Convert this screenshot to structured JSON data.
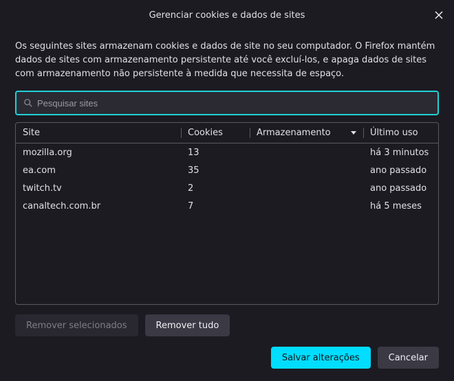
{
  "dialog": {
    "title": "Gerenciar cookies e dados de sites",
    "description": "Os seguintes sites armazenam cookies e dados de site no seu computador. O Firefox mantém dados de sites com armazenamento persistente até você excluí-los, e apaga dados de sites com armazenamento não persistente à medida que necessita de espaço."
  },
  "search": {
    "placeholder": "Pesquisar sites",
    "value": ""
  },
  "table": {
    "columns": {
      "site": "Site",
      "cookies": "Cookies",
      "storage": "Armazenamento",
      "lastused": "Último uso"
    },
    "sort": {
      "column": "storage",
      "dir": "desc"
    },
    "rows": [
      {
        "site": "mozilla.org",
        "cookies": "13",
        "storage": "",
        "lastused": "há 3 minutos"
      },
      {
        "site": "ea.com",
        "cookies": "35",
        "storage": "",
        "lastused": "ano passado"
      },
      {
        "site": "twitch.tv",
        "cookies": "2",
        "storage": "",
        "lastused": "ano passado"
      },
      {
        "site": "canaltech.com.br",
        "cookies": "7",
        "storage": "",
        "lastused": "há 5 meses"
      }
    ]
  },
  "buttons": {
    "remove_selected": "Remover selecionados",
    "remove_all": "Remover tudo",
    "save": "Salvar alterações",
    "cancel": "Cancelar"
  }
}
